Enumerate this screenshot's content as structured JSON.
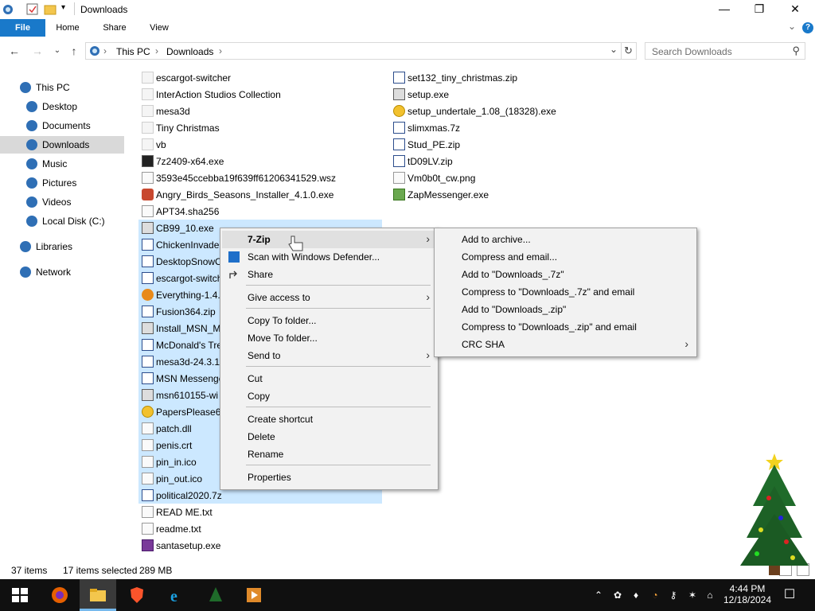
{
  "window": {
    "title": "Downloads",
    "controls": {
      "minimize": "—",
      "maximize": "❐",
      "close": "✕"
    }
  },
  "ribbon": {
    "tabs": [
      "File",
      "Home",
      "Share",
      "View"
    ],
    "help": "?",
    "expand": "⌄"
  },
  "nav": {
    "back": "←",
    "forward": "→",
    "recent": "⌄",
    "up": "↑",
    "breadcrumb": [
      "This PC",
      "Downloads"
    ],
    "sep": "›",
    "dropdown": "⌄",
    "refresh": "↻",
    "search_placeholder": "Search Downloads",
    "search_icon": "⚲"
  },
  "sidebar": {
    "items": [
      {
        "label": "This PC",
        "icon": "this-pc-icon",
        "color": "#2f6fb5"
      },
      {
        "label": "Desktop",
        "icon": "desktop-icon",
        "color": "#2f6fb5"
      },
      {
        "label": "Documents",
        "icon": "documents-icon",
        "color": "#2f6fb5"
      },
      {
        "label": "Downloads",
        "icon": "downloads-icon",
        "color": "#2f6fb5",
        "selected": true
      },
      {
        "label": "Music",
        "icon": "music-icon",
        "color": "#2f6fb5"
      },
      {
        "label": "Pictures",
        "icon": "pictures-icon",
        "color": "#2f6fb5"
      },
      {
        "label": "Videos",
        "icon": "videos-icon",
        "color": "#2f6fb5"
      },
      {
        "label": "Local Disk (C:)",
        "icon": "local-disk-icon",
        "color": "#2f6fb5"
      },
      {
        "label": "Libraries",
        "icon": "libraries-icon",
        "color": "#2f6fb5"
      },
      {
        "label": "Network",
        "icon": "network-icon",
        "color": "#2f6fb5"
      }
    ]
  },
  "files_col1": [
    {
      "name": "escargot-switcher",
      "icon": "folder-icon"
    },
    {
      "name": "InterAction Studios Collection",
      "icon": "folder-icon"
    },
    {
      "name": "mesa3d",
      "icon": "folder-icon"
    },
    {
      "name": "Tiny Christmas",
      "icon": "folder-icon"
    },
    {
      "name": "vb",
      "icon": "folder-icon"
    },
    {
      "name": "7z2409-x64.exe",
      "icon": "7zip-exe-icon"
    },
    {
      "name": "3593e45ccebba19f639ff61206341529.wsz",
      "icon": "wsz-file-icon"
    },
    {
      "name": "Angry_Birds_Seasons_Installer_4.1.0.exe",
      "icon": "angry-birds-icon"
    },
    {
      "name": "APT34.sha256",
      "icon": "blank-file-icon"
    },
    {
      "name": "CB99_10.exe",
      "icon": "exe-icon",
      "selected": true
    },
    {
      "name": "ChickenInvade",
      "icon": "zip-icon",
      "selected": true
    },
    {
      "name": "DesktopSnowC",
      "icon": "zip-icon",
      "selected": true
    },
    {
      "name": "escargot-switch",
      "icon": "zip-icon",
      "selected": true
    },
    {
      "name": "Everything-1.4.",
      "icon": "everything-icon",
      "selected": true
    },
    {
      "name": "Fusion364.zip",
      "icon": "zip-icon",
      "selected": true
    },
    {
      "name": "Install_MSN_M",
      "icon": "installer-icon",
      "selected": true
    },
    {
      "name": "McDonald's Tre",
      "icon": "zip-icon",
      "selected": true
    },
    {
      "name": "mesa3d-24.3.1-",
      "icon": "zip-icon",
      "selected": true
    },
    {
      "name": "MSN Messenge",
      "icon": "zip-icon",
      "selected": true
    },
    {
      "name": "msn610155-wi",
      "icon": "installer-icon",
      "selected": true
    },
    {
      "name": "PapersPlease64",
      "icon": "papers-please-icon",
      "selected": true
    },
    {
      "name": "patch.dll",
      "icon": "dll-icon",
      "selected": true
    },
    {
      "name": "penis.crt",
      "icon": "certificate-icon",
      "selected": true
    },
    {
      "name": "pin_in.ico",
      "icon": "ico-file-icon",
      "selected": true
    },
    {
      "name": "pin_out.ico",
      "icon": "ico-file-icon",
      "selected": true
    },
    {
      "name": "political2020.7z",
      "icon": "zip-icon",
      "selected": true
    },
    {
      "name": "READ ME.txt",
      "icon": "text-file-icon"
    },
    {
      "name": "readme.txt",
      "icon": "text-file-icon"
    },
    {
      "name": "santasetup.exe",
      "icon": "santa-setup-icon"
    }
  ],
  "files_col2": [
    {
      "name": "set132_tiny_christmas.zip",
      "icon": "zip-icon"
    },
    {
      "name": "setup.exe",
      "icon": "setup-icon"
    },
    {
      "name": "setup_undertale_1.08_(18328).exe",
      "icon": "undertale-setup-icon"
    },
    {
      "name": "slimxmas.7z",
      "icon": "zip-icon"
    },
    {
      "name": "Stud_PE.zip",
      "icon": "zip-icon"
    },
    {
      "name": "tD09LV.zip",
      "icon": "zip-icon"
    },
    {
      "name": "Vm0b0t_cw.png",
      "icon": "png-file-icon"
    },
    {
      "name": "ZapMessenger.exe",
      "icon": "zap-messenger-icon"
    }
  ],
  "status": {
    "items": "37 items",
    "selected": "17 items selected",
    "size": "289 MB"
  },
  "context_menu": {
    "items": [
      {
        "label": "7-Zip",
        "submenu": true,
        "bold": true
      },
      {
        "label": "Scan with Windows Defender...",
        "icon": "defender-icon"
      },
      {
        "label": "Share",
        "icon": "share-icon"
      },
      {
        "label": "Give access to",
        "submenu": true
      },
      {
        "label": "Copy To folder..."
      },
      {
        "label": "Move To folder..."
      },
      {
        "label": "Send to",
        "submenu": true
      },
      {
        "label": "Cut"
      },
      {
        "label": "Copy"
      },
      {
        "label": "Create shortcut"
      },
      {
        "label": "Delete"
      },
      {
        "label": "Rename"
      },
      {
        "label": "Properties"
      }
    ],
    "arrow": "›"
  },
  "submenu": {
    "items": [
      {
        "label": "Add to archive..."
      },
      {
        "label": "Compress and email..."
      },
      {
        "label": "Add to \"Downloads_.7z\""
      },
      {
        "label": "Compress to \"Downloads_.7z\" and email"
      },
      {
        "label": "Add to \"Downloads_.zip\""
      },
      {
        "label": "Compress to \"Downloads_.zip\" and email"
      },
      {
        "label": "CRC SHA",
        "submenu": true
      }
    ]
  },
  "taskbar": {
    "apps": [
      "start-button",
      "firefox-icon",
      "file-explorer-icon",
      "brave-icon",
      "internet-explorer-icon",
      "tree-99-icon",
      "media-player-icon"
    ],
    "tray_glyphs": [
      "⌃",
      "✿",
      "♦",
      "◔",
      "⚷",
      "✶",
      "⌂",
      "◁"
    ],
    "time": "4:44 PM",
    "date": "12/18/2024",
    "notification": "☐"
  },
  "colors": {
    "accent": "#1979ca",
    "selection": "#cce8ff",
    "taskbar": "#101010",
    "menu_bg": "#f2f2f2"
  }
}
